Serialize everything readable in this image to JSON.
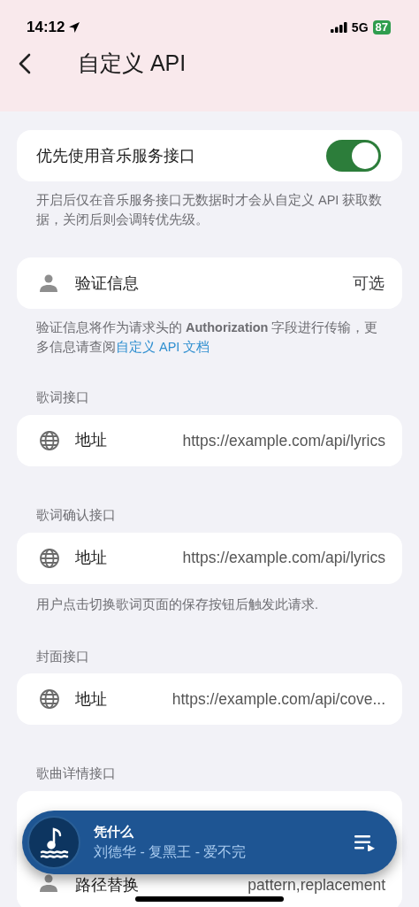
{
  "status_bar": {
    "time": "14:12",
    "network": "5G",
    "battery": "87"
  },
  "header": {
    "title": "自定义 API"
  },
  "priority_card": {
    "label": "优先使用音乐服务接口",
    "on": true
  },
  "priority_note": "开启后仅在音乐服务接口无数据时才会从自定义 API 获取数据，关闭后则会调转优先级。",
  "auth_card": {
    "label": "验证信息",
    "value": "可选"
  },
  "auth_note": {
    "text": "验证信息将作为请求头的 **Authorization** 字段进行传输，更多信息请查阅",
    "link": "自定义 API 文档"
  },
  "sections": [
    {
      "title": "歌词接口",
      "rows": [
        {
          "label": "地址",
          "value": "https://example.com/api/lyrics"
        }
      ]
    },
    {
      "title": "歌词确认接口",
      "rows": [
        {
          "label": "地址",
          "value": "https://example.com/api/lyrics"
        }
      ],
      "note": "用户点击切换歌词页面的保存按钮后触发此请求."
    },
    {
      "title": "封面接口",
      "rows": [
        {
          "label": "地址",
          "value": "https://example.com/api/cove..."
        }
      ]
    },
    {
      "title": "歌曲详情接口",
      "rows": [
        {
          "label": "路径替换",
          "value": "pattern,replacement"
        }
      ]
    }
  ],
  "player": {
    "title": "凭什么",
    "subtitle": "刘德华 - 复黑王 - 爱不完"
  }
}
